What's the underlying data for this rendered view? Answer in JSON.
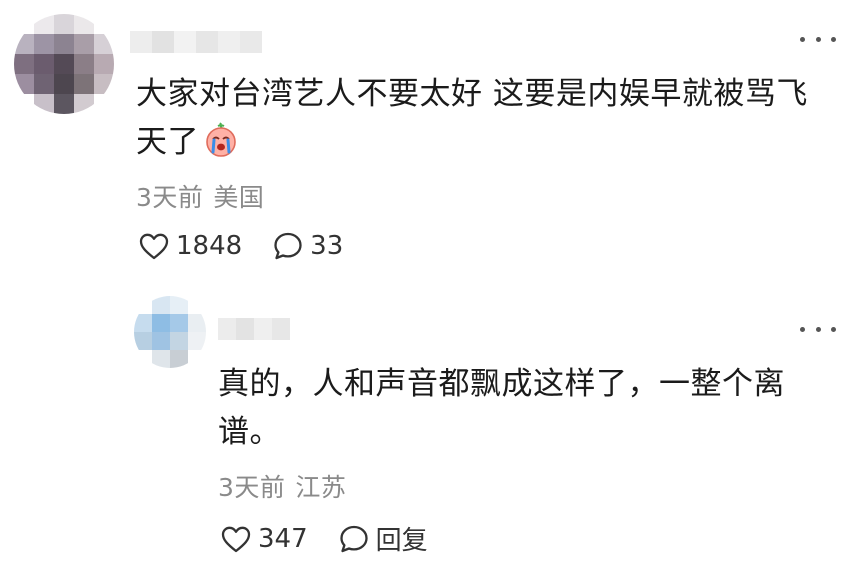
{
  "main_comment": {
    "text_line1": "大家对台湾艺人不要太好 这要是内娱早就被骂飞",
    "text_line2": "天了",
    "emoji": "crying-face-emoji",
    "time": "3天前",
    "location": "美国",
    "like_count": "1848",
    "reply_count": "33"
  },
  "reply_comment": {
    "text_line1": "真的，人和声音都飘成这样了，一整个离",
    "text_line2": "谱。",
    "time": "3天前",
    "location": "江苏",
    "like_count": "347",
    "reply_label": "回复"
  },
  "icons": {
    "like": "heart-outline-icon",
    "comment": "speech-bubble-icon",
    "more": "more-dots-icon"
  },
  "colors": {
    "text": "#1b1b1b",
    "meta": "#8a8a8a",
    "icon": "#333333"
  }
}
